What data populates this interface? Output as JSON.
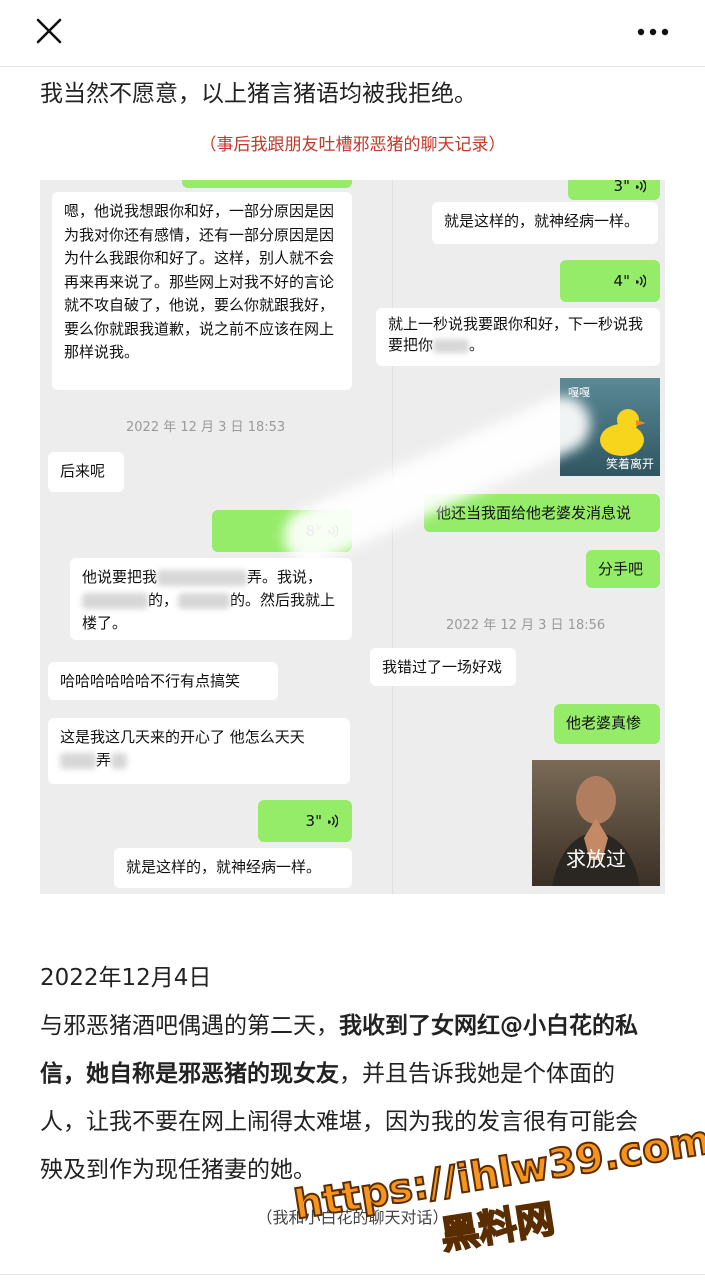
{
  "topbar": {
    "close_icon": "close-icon",
    "more_icon": "more-icon"
  },
  "article": {
    "intro": "我当然不愿意，以上猪言猪语均被我拒绝。",
    "caption_top": "（事后我跟朋友吐槽邪恶猪的聊天记录）",
    "date": "2022年12月4日",
    "para_lines": [
      {
        "normal": "与邪恶猪酒吧偶遇的第二天，",
        "bold": "我收到了女网红@小白花的私"
      },
      {
        "bold": "信，她自称是邪恶猪的现女友",
        "normal": "，并且告诉我她是个体面的"
      },
      {
        "normal": "人，让我不要在网上闹得太难堪，因为我的发言很有可能会"
      },
      {
        "normal": "殃及到作为现任猪妻的她。"
      }
    ],
    "caption_bottom": "（我和小白花的聊天对话）"
  },
  "chat_left": {
    "msg1": "嗯，他说我想跟你和好，一部分原因是因为我对你还有感情，还有一部分原因是因为什么我跟你和好了。这样，别人就不会再来再来说了。那些网上对我不好的言论就不攻自破了，他说，要么你就跟我好，要么你就跟我道歉，说之前不应该在网上那样说我。",
    "ts1": "2022 年 12 月 3 日  18:53",
    "msg2": "后来呢",
    "voice1": "8\"",
    "msg3_a": "他说要把我",
    "msg3_b": "弄",
    "msg3_c": "。我说，",
    "msg3_d": "的，",
    "msg3_e": "的。然后我就上楼了。",
    "msg4": "哈哈哈哈哈哈不行有点搞笑",
    "msg5_a": "这是我这几天来的开心了 他怎么天天",
    "msg5_b": "弄",
    "voice2": "3\"",
    "msg6": "就是这样的，就神经病一样。"
  },
  "chat_right": {
    "voice0": "3\"",
    "msg1": "就是这样的，就神经病一样。",
    "voice1": "4\"",
    "msg2_a": "就上一秒说我要跟你和好，下一秒说我要把你",
    "msg2_b": "。",
    "sticker1_label_top": "嘎嘎",
    "sticker1_label_bottom": "笑着离开",
    "msg3": "他还当我面给他老婆发消息说",
    "msg4": "分手吧",
    "ts1": "2022 年 12 月 3 日  18:56",
    "msg5": "我错过了一场好戏",
    "msg6": "他老婆真惨",
    "sticker2_label": "求放过"
  },
  "watermark": {
    "line1": "https://ihlw39.com",
    "line2": "黑料网"
  },
  "colors": {
    "bubble_green": "#95ec69",
    "caption_red": "#c0392b",
    "chat_bg": "#ededed",
    "watermark": "#f7941d"
  }
}
